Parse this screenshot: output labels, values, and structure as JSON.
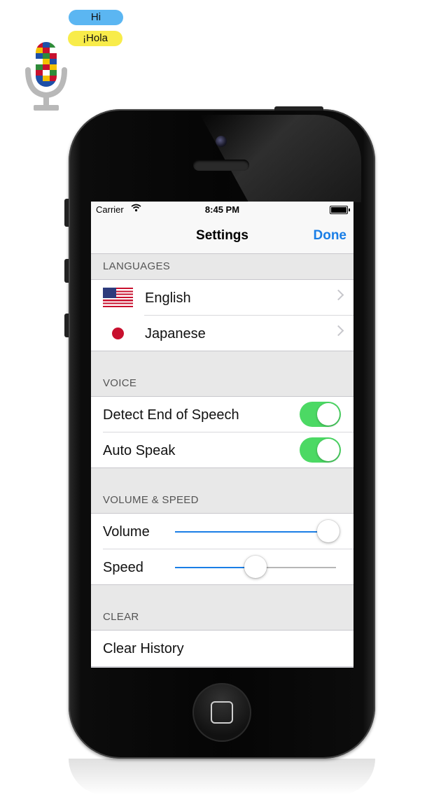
{
  "logo": {
    "bubble_hi": "Hi",
    "bubble_hola": "¡Hola",
    "icon": "flag-microphone-icon"
  },
  "statusbar": {
    "carrier": "Carrier",
    "time": "8:45 PM",
    "wifi_icon": "wifi-icon",
    "battery_icon": "battery-icon"
  },
  "navbar": {
    "title": "Settings",
    "done_label": "Done"
  },
  "sections": {
    "languages": {
      "header": "LANGUAGES",
      "items": [
        {
          "label": "English",
          "flag": "us-flag-icon"
        },
        {
          "label": "Japanese",
          "flag": "japan-flag-icon"
        }
      ]
    },
    "voice": {
      "header": "VOICE",
      "items": [
        {
          "label": "Detect End of Speech",
          "on": true
        },
        {
          "label": "Auto Speak",
          "on": true
        }
      ]
    },
    "volume_speed": {
      "header": "VOLUME & SPEED",
      "items": [
        {
          "label": "Volume",
          "value": 0.95
        },
        {
          "label": "Speed",
          "value": 0.5
        }
      ]
    },
    "clear": {
      "header": "CLEAR",
      "items": [
        {
          "label": "Clear History"
        }
      ]
    }
  },
  "colors": {
    "accent": "#1a7ee6",
    "toggle_on": "#4cd964",
    "section_bg": "#e8e8e8"
  }
}
